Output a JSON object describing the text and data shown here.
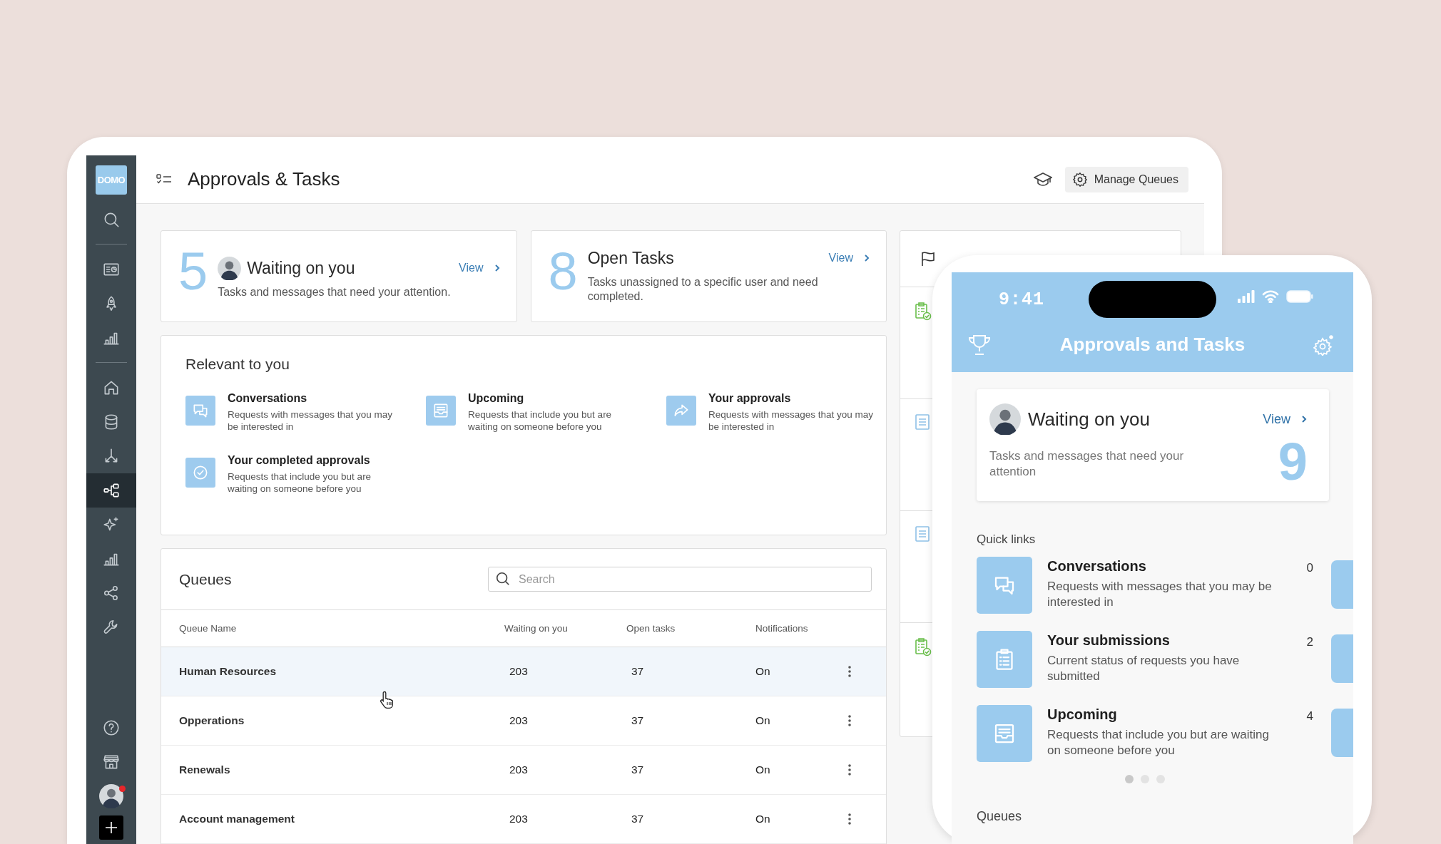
{
  "sidebar": {
    "logo": "DOMO",
    "items": [
      {
        "selected": false
      },
      {
        "selected": false
      },
      {
        "selected": false
      },
      {
        "selected": false
      },
      {
        "selected": false
      },
      {
        "selected": false
      },
      {
        "selected": false
      },
      {
        "selected": true
      },
      {
        "selected": false
      },
      {
        "selected": false
      },
      {
        "selected": false
      },
      {
        "selected": false
      },
      {
        "selected": false
      },
      {
        "selected": false
      }
    ],
    "user": {
      "notification": true
    }
  },
  "header": {
    "title": "Approvals & Tasks",
    "manage_button": "Manage Queues"
  },
  "summary_cards": [
    {
      "count": "5",
      "title": "Waiting on you",
      "avatar": true,
      "link": "View",
      "description": "Tasks and messages that need your attention."
    },
    {
      "count": "8",
      "title": "Open Tasks",
      "avatar": false,
      "link": "View",
      "description": "Tasks unassigned to a specific user and need completed."
    }
  ],
  "relevant": {
    "title": "Relevant to you",
    "items": [
      {
        "title": "Conversations",
        "description": "Requests with messages that you may be interested in"
      },
      {
        "title": "Upcoming",
        "description": "Requests that include you but are waiting on someone before you"
      },
      {
        "title": "Your approvals",
        "description": "Requests with messages that you may be interested in"
      },
      {
        "title": "Your completed approvals",
        "description": "Requests that include you but are waiting on someone before you"
      }
    ]
  },
  "queues": {
    "title": "Queues",
    "search": {
      "placeholder": "Search"
    },
    "columns": [
      "Queue Name",
      "Waiting on you",
      "Open tasks",
      "Notifications"
    ],
    "rows": [
      {
        "name": "Human Resources",
        "waiting": "203",
        "open_tasks": "37",
        "notifications": "On",
        "selected": true
      },
      {
        "name": "Opperations",
        "waiting": "203",
        "open_tasks": "37",
        "notifications": "On",
        "selected": false
      },
      {
        "name": "Renewals",
        "waiting": "203",
        "open_tasks": "37",
        "notifications": "On",
        "selected": false
      },
      {
        "name": "Account management",
        "waiting": "203",
        "open_tasks": "37",
        "notifications": "On",
        "selected": false
      }
    ]
  },
  "phone": {
    "time": "9:41",
    "title": "Approvals and Tasks",
    "card": {
      "title": "Waiting on you",
      "link": "View",
      "description": "Tasks and messages that need your attention",
      "count": "9"
    },
    "quick_links": {
      "title": "Quick links",
      "items": [
        {
          "title": "Conversations",
          "description": "Requests with messages that you may be interested in",
          "count": "0"
        },
        {
          "title": "Your submissions",
          "description": "Current status of requests you have submitted",
          "count": "2"
        },
        {
          "title": "Upcoming",
          "description": "Requests that include you but are waiting on someone before you",
          "count": "4"
        }
      ]
    },
    "carousel": [
      {
        "selected": true
      },
      {
        "selected": false
      },
      {
        "selected": false
      }
    ],
    "queues_title": "Queues"
  }
}
